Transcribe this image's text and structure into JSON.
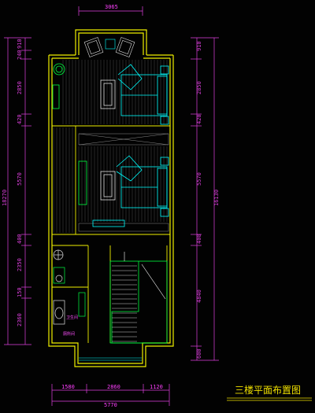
{
  "drawing": {
    "title": "三楼平面布置图",
    "top_dims": [
      "3065"
    ],
    "bottom_dims": [
      "1580",
      "2860",
      "1120"
    ],
    "bottom_total": "5770",
    "left_dims": [
      "910",
      "240",
      "2850",
      "420",
      "5570",
      "400",
      "2350",
      "150",
      "2360"
    ],
    "left_total": "18270",
    "right_dims": [
      "910",
      "2850",
      "420",
      "5570",
      "400",
      "4840",
      "600"
    ],
    "right_total": "16130",
    "room_labels": [
      "卫生间",
      "厕所间"
    ]
  },
  "colors": {
    "background": "#020202",
    "wall": "#f0f000",
    "furniture": "#00ffff",
    "green": "#00ff40",
    "dim": "#e040e0"
  }
}
